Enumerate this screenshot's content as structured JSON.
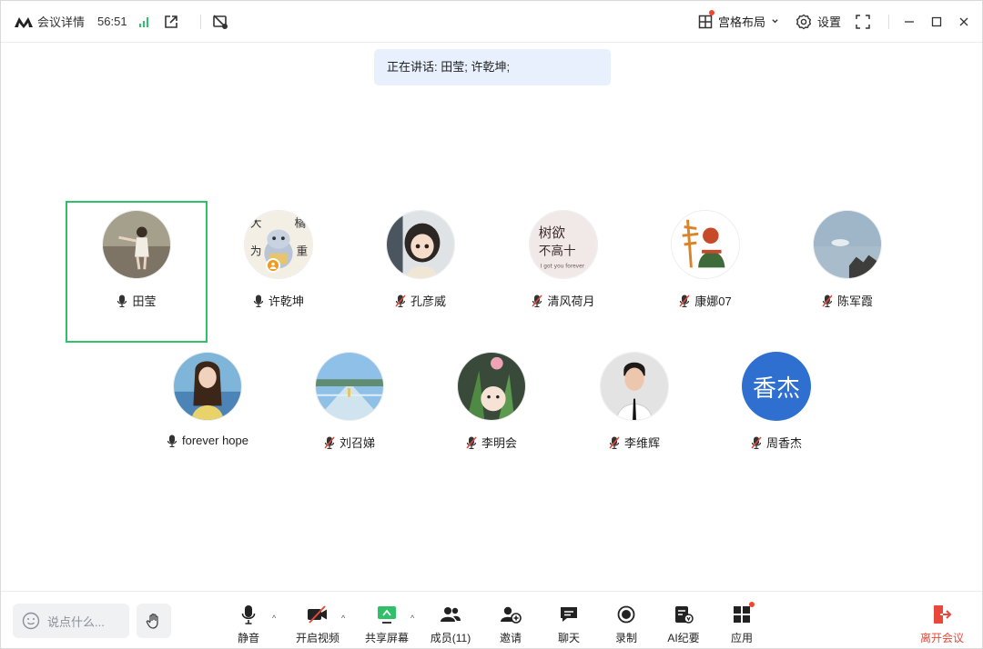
{
  "topbar": {
    "title": "会议详情",
    "timer": "56:51",
    "layout_label": "宫格布局",
    "settings_label": "设置"
  },
  "speaking": {
    "text": "正在讲话: 田莹; 许乾坤;"
  },
  "participants": [
    {
      "name": "田莹",
      "mic": "on",
      "active": true
    },
    {
      "name": "许乾坤",
      "mic": "on",
      "host": true
    },
    {
      "name": "孔彦威",
      "mic": "muted"
    },
    {
      "name": "清风荷月",
      "mic": "muted"
    },
    {
      "name": "康娜07",
      "mic": "muted"
    },
    {
      "name": "陈军霞",
      "mic": "muted"
    },
    {
      "name": "forever hope",
      "mic": "on"
    },
    {
      "name": "刘召娣",
      "mic": "muted"
    },
    {
      "name": "李明会",
      "mic": "muted"
    },
    {
      "name": "李维辉",
      "mic": "muted"
    },
    {
      "name": "周香杰",
      "mic": "muted",
      "avatar_text": "香杰"
    }
  ],
  "avatar_texts": {
    "qingfeng_line1": "树欲",
    "qingfeng_line2": "不高十",
    "qingfeng_small": "I got you forever",
    "xu_chars": "大橘为重"
  },
  "bottombar": {
    "chat_placeholder": "说点什么...",
    "mute": "静音",
    "video": "开启视频",
    "share": "共享屏幕",
    "members": "成员(11)",
    "invite": "邀请",
    "chat": "聊天",
    "record": "录制",
    "ai_minutes": "AI纪要",
    "apps": "应用",
    "leave": "离开会议"
  },
  "colors": {
    "active_border": "#2fc16a",
    "leave_red": "#e8483b",
    "speaking_bg": "#e8f0fd",
    "signal_green": "#2fc16a",
    "zhou_avatar": "#2f6fd0"
  }
}
